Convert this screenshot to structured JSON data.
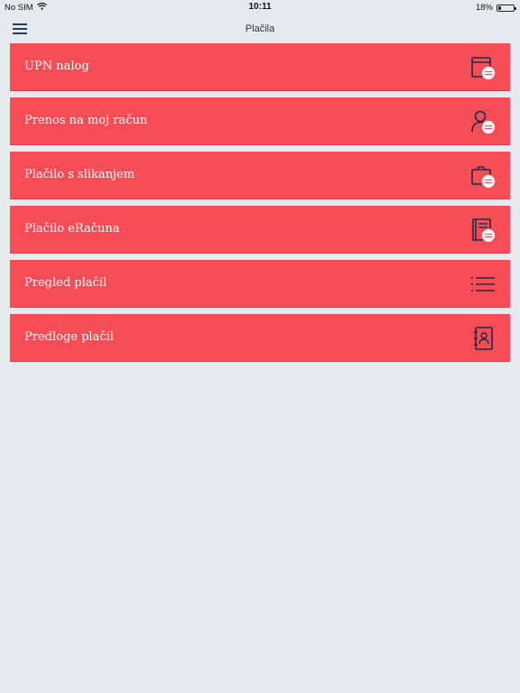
{
  "status": {
    "carrier": "No SIM",
    "time": "10:11",
    "battery_text": "18%",
    "battery_level": 0.18,
    "wifi_icon": "wifi-icon",
    "battery_icon": "battery-icon"
  },
  "nav": {
    "title": "Plačila",
    "menu_icon": "hamburger-menu-icon"
  },
  "colors": {
    "background": "#e6e9ee",
    "item_red": "#f84c57",
    "icon_navy": "#1f2b4a"
  },
  "menu": {
    "items": [
      {
        "label": "UPN nalog",
        "icon": "payment-form-transfer-icon"
      },
      {
        "label": "Prenos na moj račun",
        "icon": "person-transfer-icon"
      },
      {
        "label": "Plačilo s slikanjem",
        "icon": "camera-transfer-icon"
      },
      {
        "label": "Plačilo eRačuna",
        "icon": "notebook-transfer-icon"
      },
      {
        "label": "Pregled plačil",
        "icon": "list-icon"
      },
      {
        "label": "Predloge plačil",
        "icon": "contact-book-icon"
      }
    ]
  }
}
